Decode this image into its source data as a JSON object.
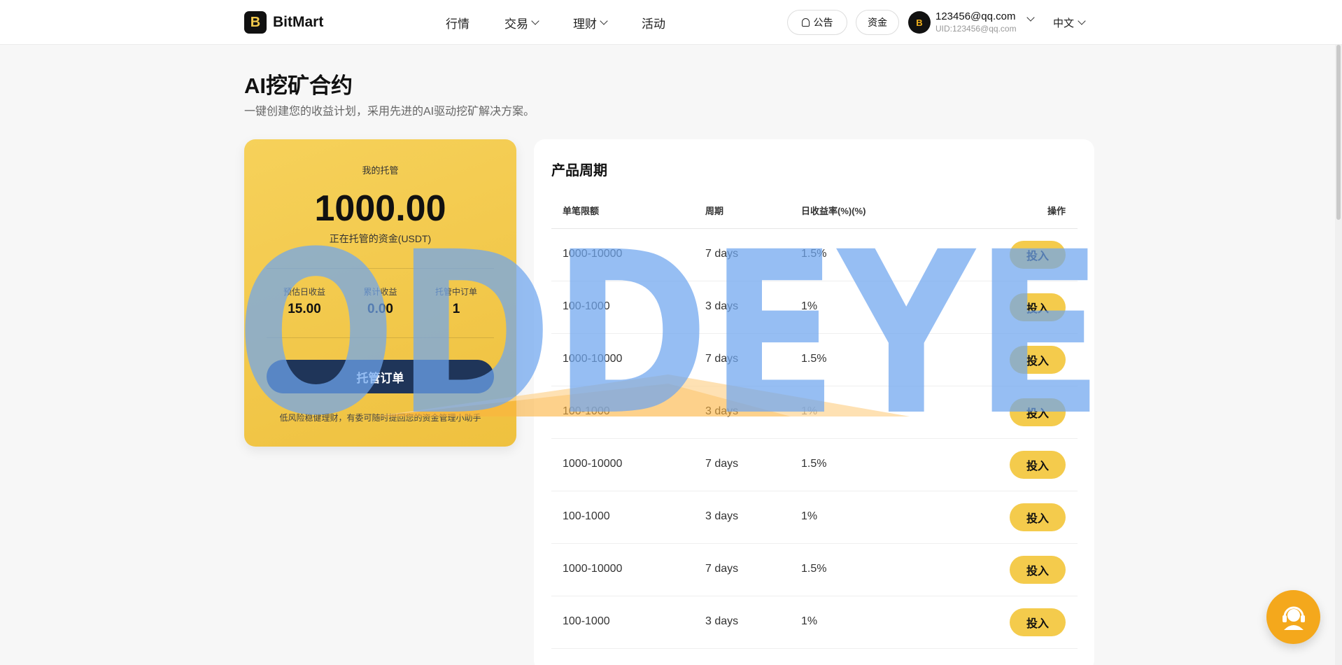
{
  "header": {
    "brand": "BitMart",
    "nav": [
      {
        "label": "行情",
        "dropdown": false
      },
      {
        "label": "交易",
        "dropdown": true
      },
      {
        "label": "理财",
        "dropdown": true
      },
      {
        "label": "活动",
        "dropdown": false
      }
    ],
    "announcement_label": "公告",
    "funds_label": "资金",
    "user_email": "123456@qq.com",
    "user_uid": "UID:123456@qq.com",
    "language": "中文"
  },
  "page": {
    "title": "AI挖矿合约",
    "subtitle": "一键创建您的收益计划，采用先进的AI驱动挖矿解决方案。"
  },
  "card": {
    "label": "我的托管",
    "amount": "1000.00",
    "amount_sub": "正在托管的资金(USDT)",
    "stats": [
      {
        "label": "预估日收益",
        "value": "15.00"
      },
      {
        "label": "累计收益",
        "value": "0.00"
      },
      {
        "label": "托管中订单",
        "value": "1"
      }
    ],
    "button": "托管订单",
    "note": "低风险稳健理财，有委可随时提回您的资金管理小助手"
  },
  "products": {
    "title": "产品周期",
    "columns": [
      "单笔限额",
      "周期",
      "日收益率(%)(%)",
      "操作"
    ],
    "action_label": "投入",
    "rows": [
      {
        "limit": "1000-10000",
        "period": "7 days",
        "rate": "1.5%"
      },
      {
        "limit": "100-1000",
        "period": "3 days",
        "rate": "1%"
      },
      {
        "limit": "1000-10000",
        "period": "7 days",
        "rate": "1.5%"
      },
      {
        "limit": "100-1000",
        "period": "3 days",
        "rate": "1%"
      },
      {
        "limit": "1000-10000",
        "period": "7 days",
        "rate": "1.5%"
      },
      {
        "limit": "100-1000",
        "period": "3 days",
        "rate": "1%"
      },
      {
        "limit": "1000-10000",
        "period": "7 days",
        "rate": "1.5%"
      },
      {
        "limit": "100-1000",
        "period": "3 days",
        "rate": "1%"
      }
    ]
  },
  "watermark": {
    "text": "ODDEYE"
  },
  "colors": {
    "card_gold": "#f2c94c",
    "button_navy": "#1f3559",
    "invest_yellow": "#f4cb4c",
    "support_orange": "#f4a81c",
    "watermark_blue": "#6fa6ef"
  }
}
